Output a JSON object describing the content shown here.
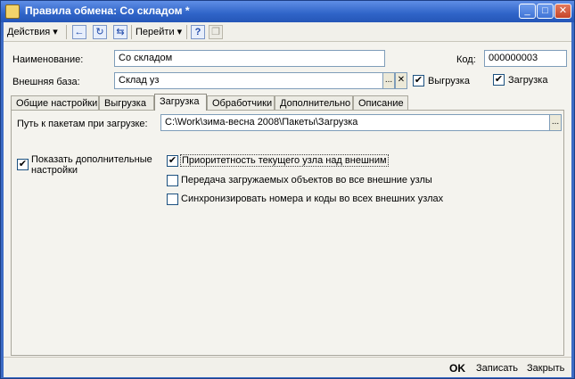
{
  "window": {
    "title": "Правила обмена: Со складом *"
  },
  "titlebar_buttons": {
    "minimize": "_",
    "maximize": "□",
    "close": "✕"
  },
  "toolbar": {
    "actions_label": "Действия",
    "goto_label": "Перейти",
    "help_label": "?",
    "dropdown_glyph": "▾"
  },
  "form": {
    "name_label": "Наименование:",
    "name_value": "Со складом",
    "code_label": "Код:",
    "code_value": "000000003",
    "external_base_label": "Внешняя база:",
    "external_base_value": "Склад уз",
    "select_glyph": "...",
    "clear_glyph": "✕",
    "export_label": "Выгрузка",
    "export_checked": true,
    "import_label": "Загрузка",
    "import_checked": true
  },
  "tabs": [
    {
      "label": "Общие настройки"
    },
    {
      "label": "Выгрузка"
    },
    {
      "label": "Загрузка",
      "active": true
    },
    {
      "label": "Обработчики"
    },
    {
      "label": "Дополнительно"
    },
    {
      "label": "Описание"
    }
  ],
  "panel": {
    "path_label": "Путь к пакетам при загрузке:",
    "path_value": "C:\\Work\\зима-весна 2008\\Пакеты\\Загрузка",
    "show_additional_label_line1": "Показать дополнительные",
    "show_additional_label_line2": "настройки",
    "show_additional_checked": true,
    "options": [
      {
        "label": "Приоритетность текущего узла над внешним",
        "checked": true
      },
      {
        "label": "Передача загружаемых объектов во все внешние узлы",
        "checked": false
      },
      {
        "label": "Синхронизировать номера  и коды во всех внешних узлах",
        "checked": false
      }
    ]
  },
  "statusbar": {
    "ok_label": "OK",
    "save_label": "Записать",
    "close_label": "Закрыть"
  },
  "glyphs": {
    "check": "✔"
  },
  "colors": {
    "title_bar": "#2f64c8",
    "form_bg": "#f4f3ee",
    "field_border": "#7f9db9"
  }
}
